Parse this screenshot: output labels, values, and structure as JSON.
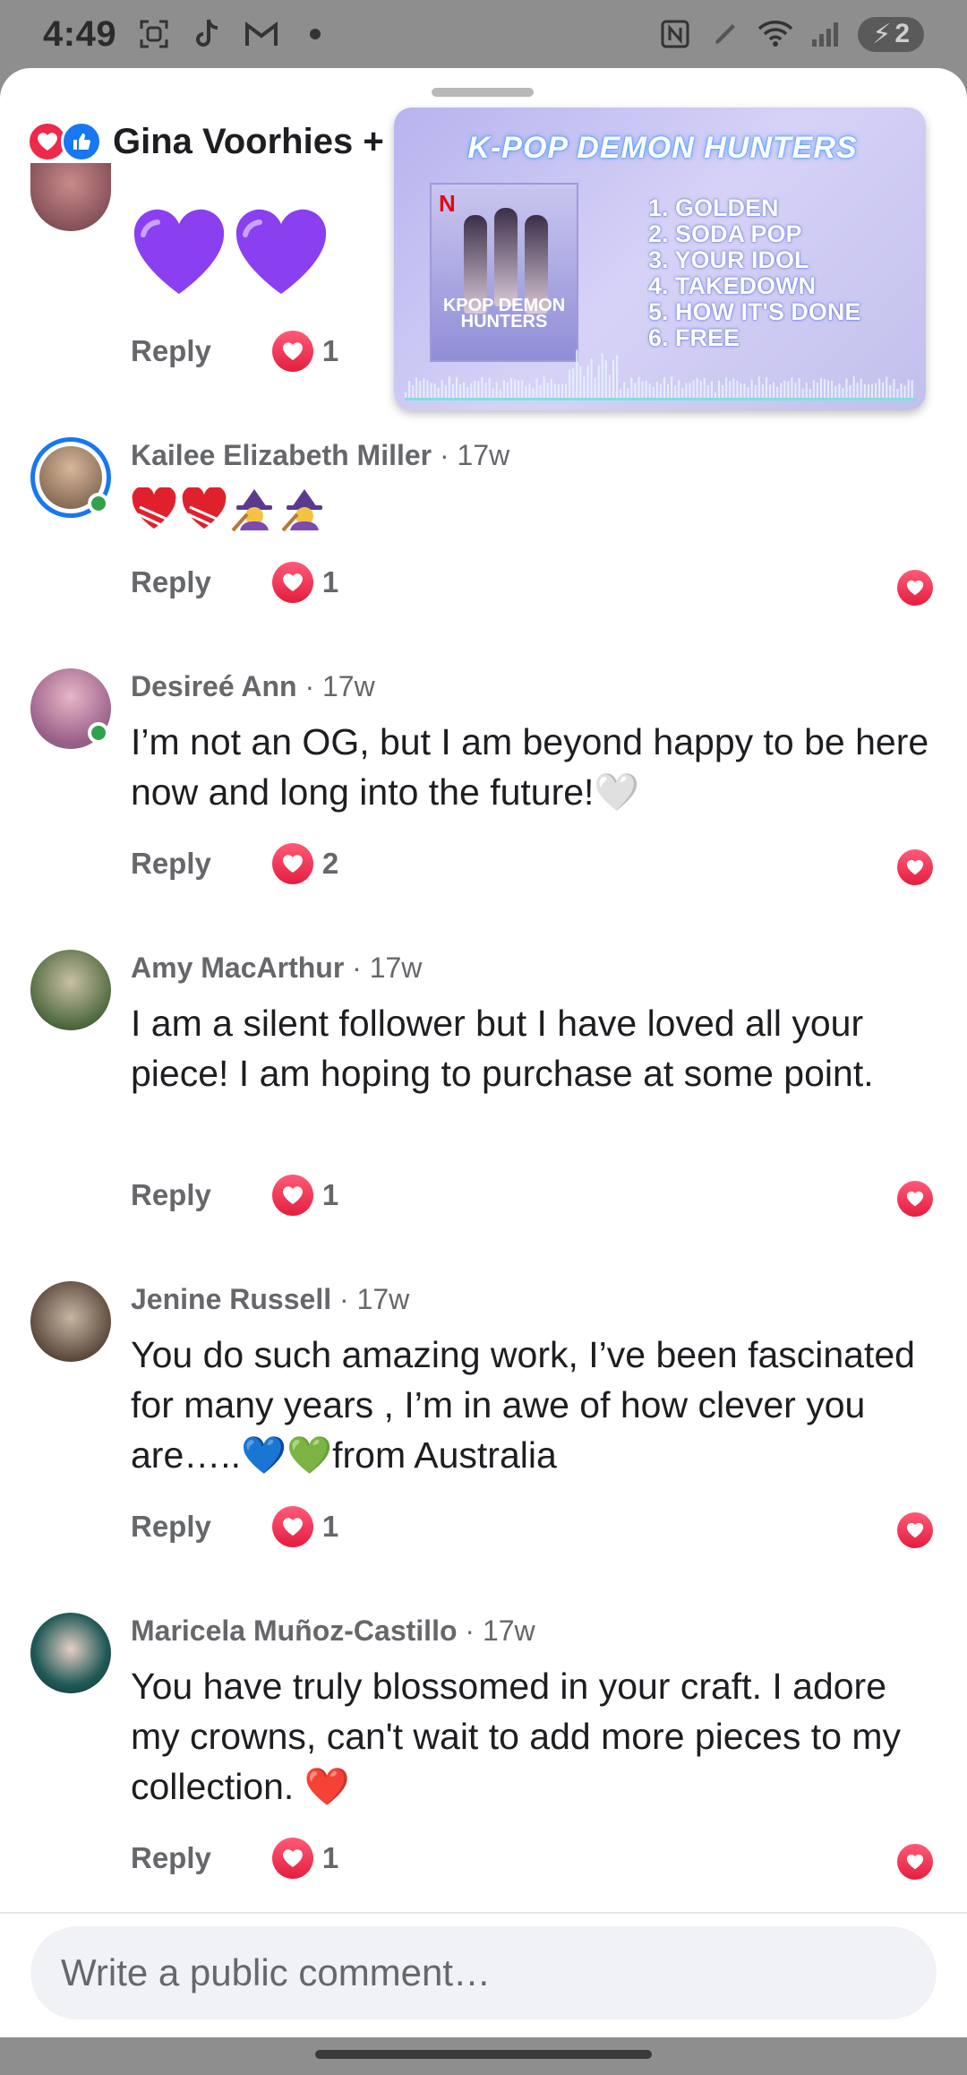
{
  "status_bar": {
    "time": "4:49",
    "battery": "2"
  },
  "header": {
    "reactors_text": "Gina Voorhies +"
  },
  "pip": {
    "title": "K-POP DEMON HUNTERS",
    "cover_title": "KPOP DEMON HUNTERS",
    "tracks": [
      "1. GOLDEN",
      "2. SODA POP",
      "3. YOUR IDOL",
      "4. TAKEDOWN",
      "5. HOW IT'S DONE",
      "6. FREE"
    ]
  },
  "labels": {
    "reply": "Reply",
    "separator": "·"
  },
  "comments": [
    {
      "name": "",
      "time": "",
      "text": "",
      "likes": "1"
    },
    {
      "name": "Kailee Elizabeth Miller",
      "time": "17w",
      "text": "",
      "likes": "1"
    },
    {
      "name": "Desireé Ann",
      "time": "17w",
      "text": "I’m not an OG, but I am beyond happy to be here now and long into the future!🤍",
      "likes": "2"
    },
    {
      "name": "Amy MacArthur",
      "time": "17w",
      "text": "I am a silent follower but I have loved all your piece! I am hoping to purchase at some point.",
      "likes": "1"
    },
    {
      "name": "Jenine Russell",
      "time": "17w",
      "text": "You do such amazing work, I’ve been fascinated for many years , I’m in awe of how clever you are…..💙💚from Australia",
      "likes": "1"
    },
    {
      "name": "Maricela Muñoz-Castillo",
      "time": "17w",
      "text": "You have truly blossomed in your craft.  I adore my crowns, can't wait to add more pieces to my collection.  ❤️",
      "likes": "1"
    }
  ],
  "composer": {
    "placeholder": "Write a public comment…"
  }
}
